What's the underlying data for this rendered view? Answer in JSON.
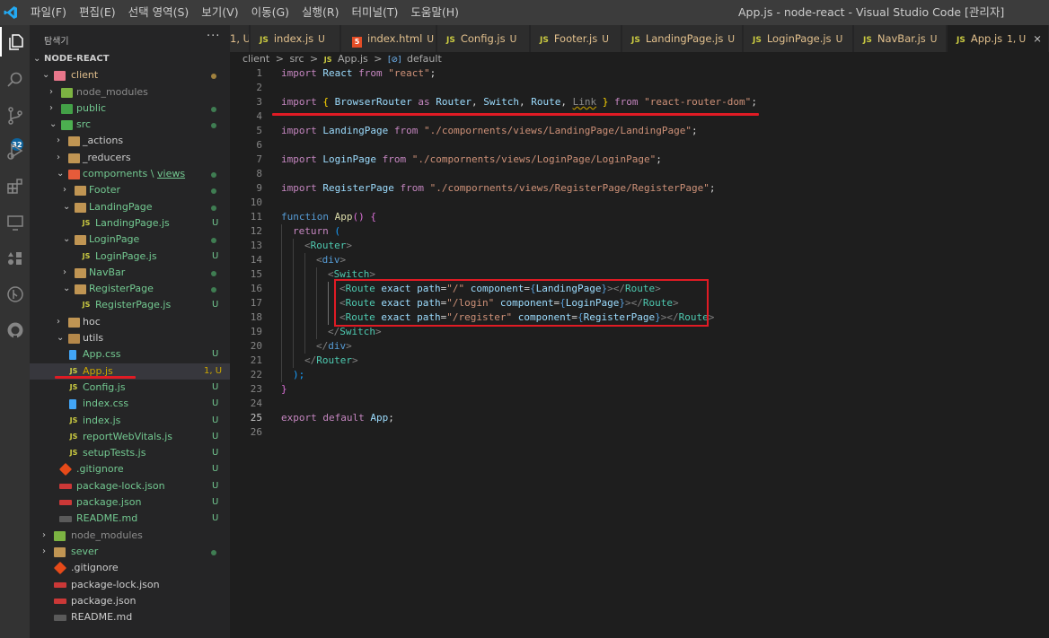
{
  "window_title": "App.js - node-react - Visual Studio Code [관리자]",
  "menu": [
    "파일(F)",
    "편집(E)",
    "선택 영역(S)",
    "보기(V)",
    "이동(G)",
    "실행(R)",
    "터미널(T)",
    "도움말(H)"
  ],
  "activity": {
    "badge": "32"
  },
  "sidebar": {
    "title": "탐색기",
    "more": "···",
    "root": "NODE-REACT",
    "items": [
      {
        "label": "client"
      },
      {
        "label": "node_modules"
      },
      {
        "label": "public"
      },
      {
        "label": "src"
      },
      {
        "label": "_actions"
      },
      {
        "label": "_reducers"
      },
      {
        "label": "compornents",
        "label_b": "views"
      },
      {
        "label": "Footer"
      },
      {
        "label": "LandingPage"
      },
      {
        "label": "LandingPage.js",
        "status": "U"
      },
      {
        "label": "LoginPage"
      },
      {
        "label": "LoginPage.js",
        "status": "U"
      },
      {
        "label": "NavBar"
      },
      {
        "label": "RegisterPage"
      },
      {
        "label": "RegisterPage.js",
        "status": "U"
      },
      {
        "label": "hoc"
      },
      {
        "label": "utils"
      },
      {
        "label": "App.css",
        "status": "U"
      },
      {
        "label": "App.js",
        "status": "1, U"
      },
      {
        "label": "Config.js",
        "status": "U"
      },
      {
        "label": "index.css",
        "status": "U"
      },
      {
        "label": "index.js",
        "status": "U"
      },
      {
        "label": "reportWebVitals.js",
        "status": "U"
      },
      {
        "label": "setupTests.js",
        "status": "U"
      },
      {
        "label": ".gitignore",
        "status": "U"
      },
      {
        "label": "package-lock.json",
        "status": "U"
      },
      {
        "label": "package.json",
        "status": "U"
      },
      {
        "label": "README.md",
        "status": "U"
      },
      {
        "label": "node_modules"
      },
      {
        "label": "sever"
      },
      {
        "label": ".gitignore"
      },
      {
        "label": "package-lock.json"
      },
      {
        "label": "package.json"
      },
      {
        "label": "README.md"
      }
    ]
  },
  "tabs": [
    {
      "icon": "JS",
      "label": "index.js",
      "status": "U"
    },
    {
      "icon": "5",
      "label": "index.html",
      "status": "U"
    },
    {
      "icon": "JS",
      "label": "Config.js",
      "status": "U"
    },
    {
      "icon": "JS",
      "label": "Footer.js",
      "status": "U"
    },
    {
      "icon": "JS",
      "label": "LandingPage.js",
      "status": "U"
    },
    {
      "icon": "JS",
      "label": "LoginPage.js",
      "status": "U"
    },
    {
      "icon": "JS",
      "label": "NavBar.js",
      "status": "U"
    },
    {
      "icon": "JS",
      "label": "App.js",
      "status": "1, U",
      "close": "×"
    }
  ],
  "breadcrumb": [
    "client",
    ">",
    "src",
    ">",
    "JS",
    "App.js",
    ">",
    "[⊘]",
    "default"
  ],
  "code": {
    "line_numbers": [
      "1",
      "2",
      "3",
      "4",
      "5",
      "6",
      "7",
      "8",
      "9",
      "10",
      "11",
      "12",
      "13",
      "14",
      "15",
      "16",
      "17",
      "18",
      "19",
      "20",
      "21",
      "22",
      "23",
      "24",
      "25",
      "26"
    ],
    "l1": {
      "kw1": "import",
      "id": " React ",
      "kw2": "from",
      "s": " \"react\"",
      "end": ";"
    },
    "l3": {
      "kw1": "import",
      "ob": " { ",
      "a": "BrowserRouter",
      "as": " as ",
      "b": "Router",
      "c1": ", ",
      "c": "Switch",
      "c2": ", ",
      "d": "Route",
      "c3": ", ",
      "e": "Link",
      "cb": " } ",
      "kw2": "from",
      "s": " \"react-router-dom\"",
      "end": ";"
    },
    "l5": {
      "kw1": "import",
      "id": " LandingPage ",
      "kw2": "from",
      "s": " \"./compornents/views/LandingPage/LandingPage\"",
      "end": ";"
    },
    "l7": {
      "kw1": "import",
      "id": " LoginPage ",
      "kw2": "from",
      "s": " \"./compornents/views/LoginPage/LoginPage\"",
      "end": ";"
    },
    "l9": {
      "kw1": "import",
      "id": " RegisterPage ",
      "kw2": "from",
      "s": " \"./compornents/views/RegisterPage/RegisterPage\"",
      "end": ";"
    },
    "l11": {
      "kw": "function",
      "fn": " App",
      "p": "()",
      "b": " {"
    },
    "l12": {
      "kw": "return",
      "p": " ("
    },
    "l13": {
      "tag": "Router"
    },
    "l14": {
      "tag": "div"
    },
    "l15": {
      "tag": "Switch"
    },
    "route": {
      "tag": "Route",
      "exact": "exact",
      "path": "path",
      "component": "component"
    },
    "routes": [
      {
        "path": "\"/\"",
        "comp": "LandingPage"
      },
      {
        "path": "\"/login\"",
        "comp": "LoginPage"
      },
      {
        "path": "\"/register\"",
        "comp": "RegisterPage"
      }
    ],
    "l19": {
      "tag": "Switch"
    },
    "l20": {
      "tag": "div"
    },
    "l21": {
      "tag": "Router"
    },
    "l22": {
      "t": ");"
    },
    "l23": {
      "t": "}"
    },
    "l25": {
      "kw1": "export",
      "kw2": "default",
      "id": " App",
      "end": ";"
    }
  }
}
